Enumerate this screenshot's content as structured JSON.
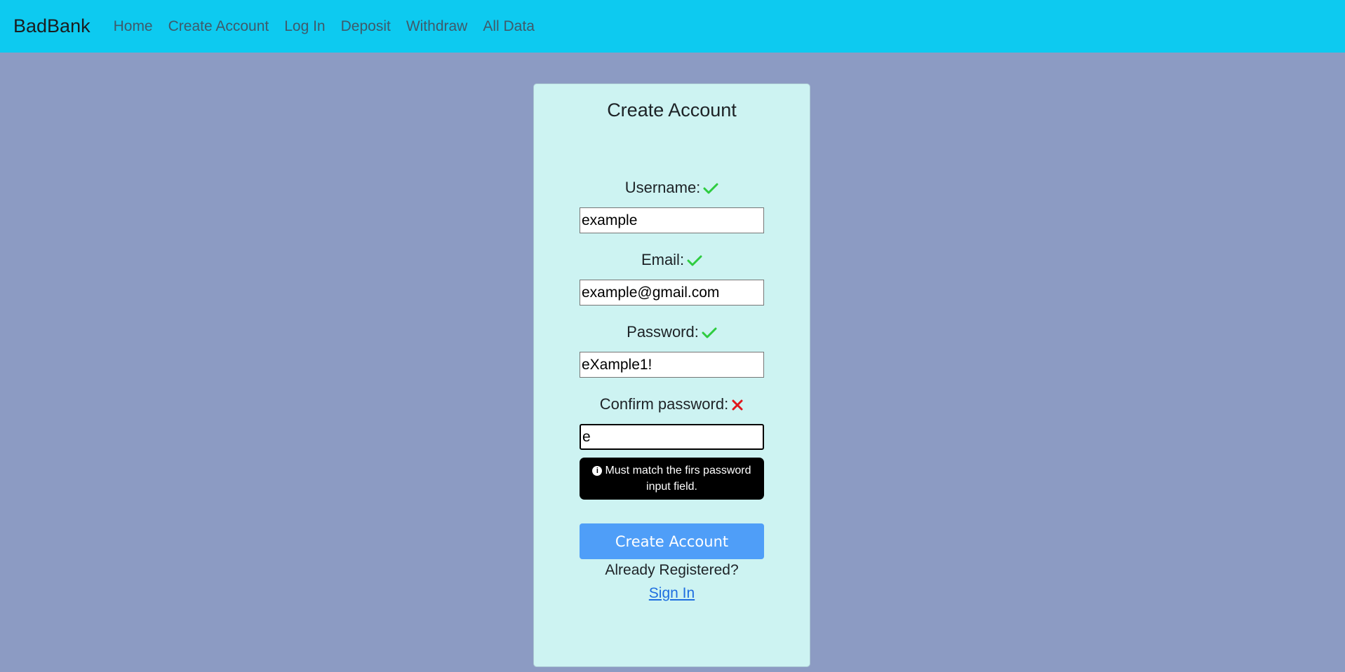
{
  "nav": {
    "brand": "BadBank",
    "links": [
      "Home",
      "Create Account",
      "Log In",
      "Deposit",
      "Withdraw",
      "All Data"
    ]
  },
  "form": {
    "title": "Create Account",
    "username": {
      "label": "Username:",
      "value": "example",
      "status": "valid",
      "status_icon": "check-icon"
    },
    "email": {
      "label": "Email:",
      "value": "example@gmail.com",
      "status": "valid",
      "status_icon": "check-icon"
    },
    "password": {
      "label": "Password:",
      "value": "eXample1!",
      "status": "valid",
      "status_icon": "check-icon"
    },
    "confirm": {
      "label": "Confirm password:",
      "value": "e",
      "status": "invalid",
      "status_icon": "x-icon"
    },
    "tooltip": {
      "icon": "info-icon",
      "line1": "Must match the firs password",
      "line2": "input field."
    },
    "submit_label": "Create Account",
    "already_text": "Already Registered?",
    "signin_label": "Sign In"
  },
  "colors": {
    "navbar": "#0dcaf0",
    "background": "#8c9bc3",
    "card": "#cdf3f2",
    "valid": "#2ecc40",
    "invalid": "#e0161b",
    "button": "#4f9ef8",
    "link": "#1f6fe0"
  }
}
